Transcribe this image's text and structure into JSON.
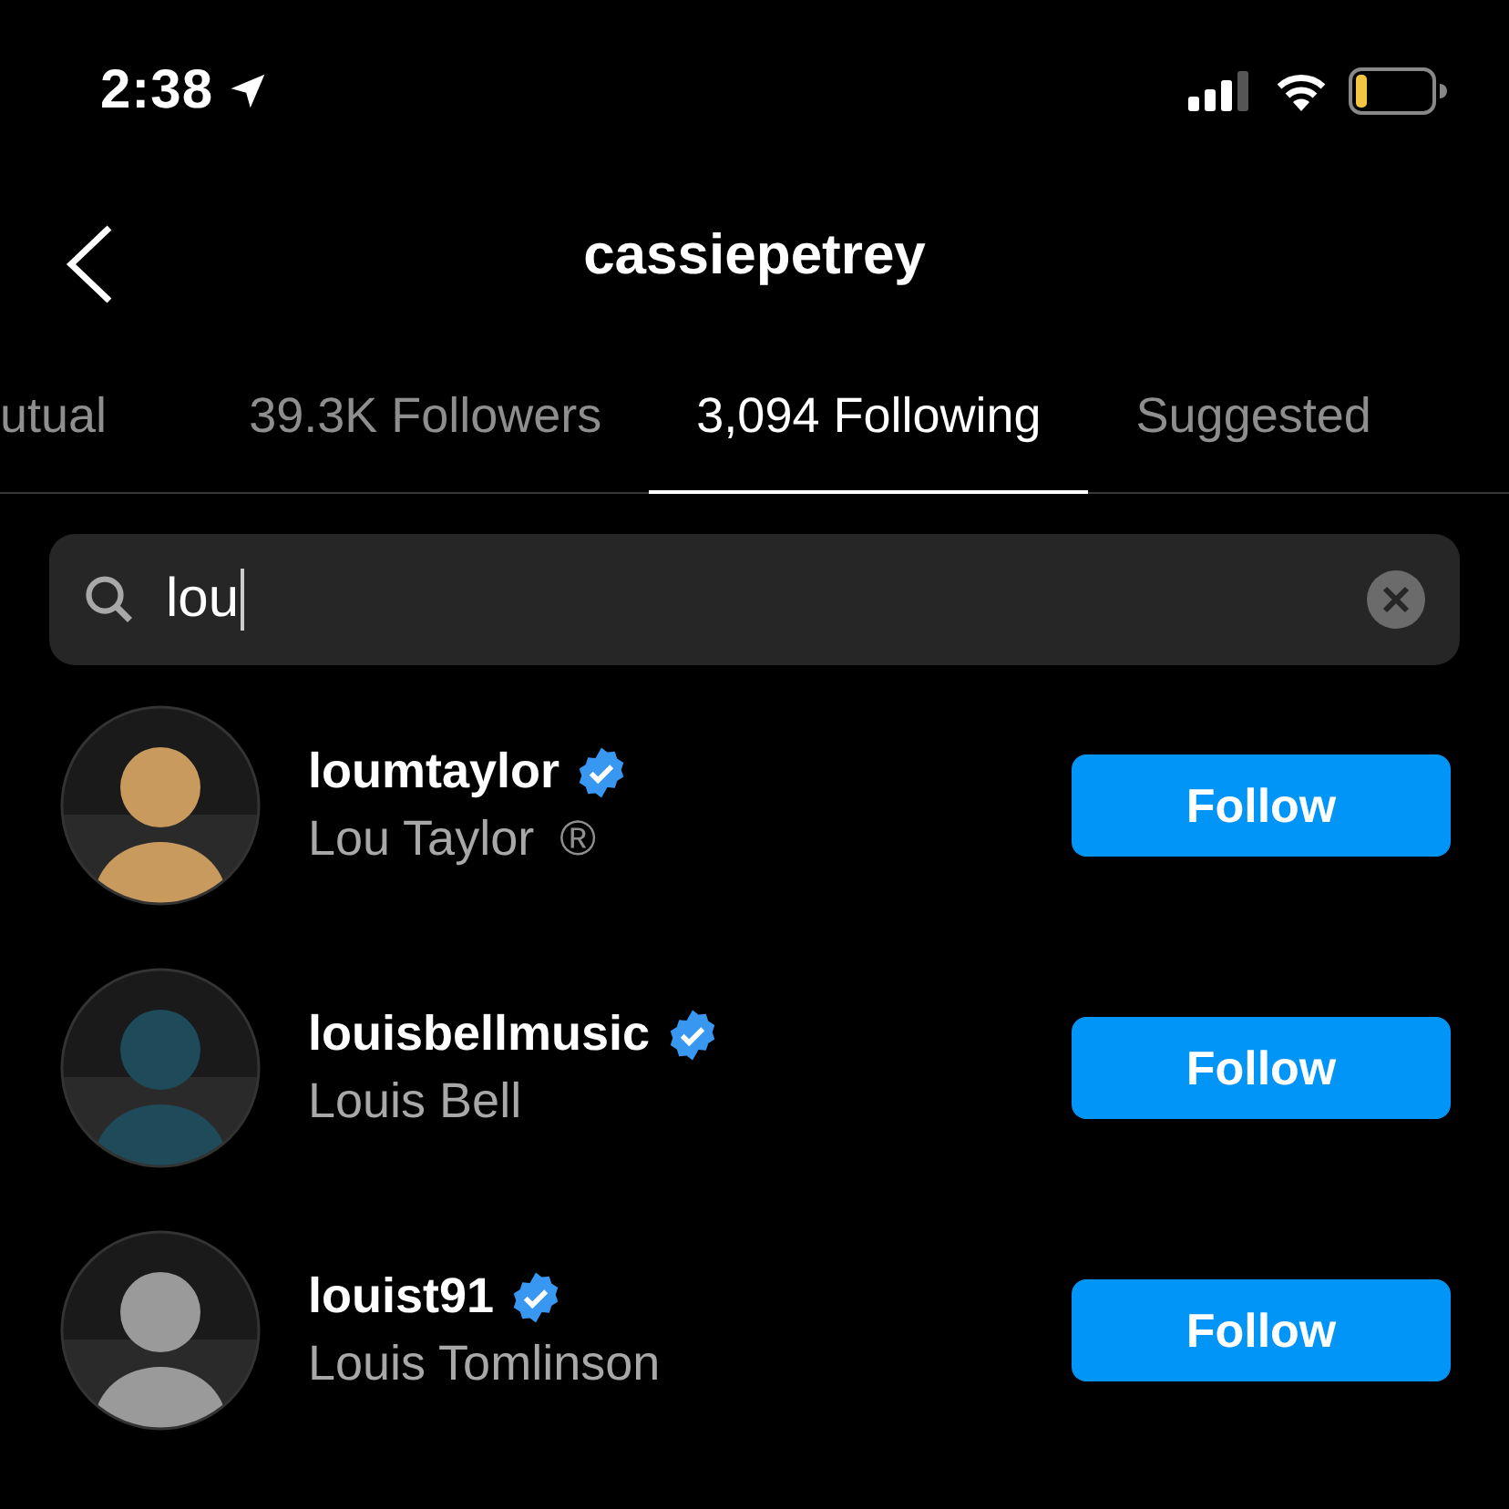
{
  "status_bar": {
    "time": "2:38",
    "location_on": true
  },
  "header": {
    "title": "cassiepetrey"
  },
  "tabs": [
    {
      "label": "utual",
      "selected": false
    },
    {
      "label": "39.3K Followers",
      "selected": false
    },
    {
      "label": "3,094 Following",
      "selected": true
    },
    {
      "label": "Suggested",
      "selected": false
    }
  ],
  "search": {
    "value": "lou"
  },
  "rows": [
    {
      "username": "loumtaylor",
      "verified": true,
      "full_name": "Lou Taylor",
      "suffix": "®",
      "button": "Follow"
    },
    {
      "username": "louisbellmusic",
      "verified": true,
      "full_name": "Louis Bell",
      "button": "Follow"
    },
    {
      "username": "louist91",
      "verified": true,
      "full_name": "Louis Tomlinson",
      "button": "Follow"
    }
  ]
}
